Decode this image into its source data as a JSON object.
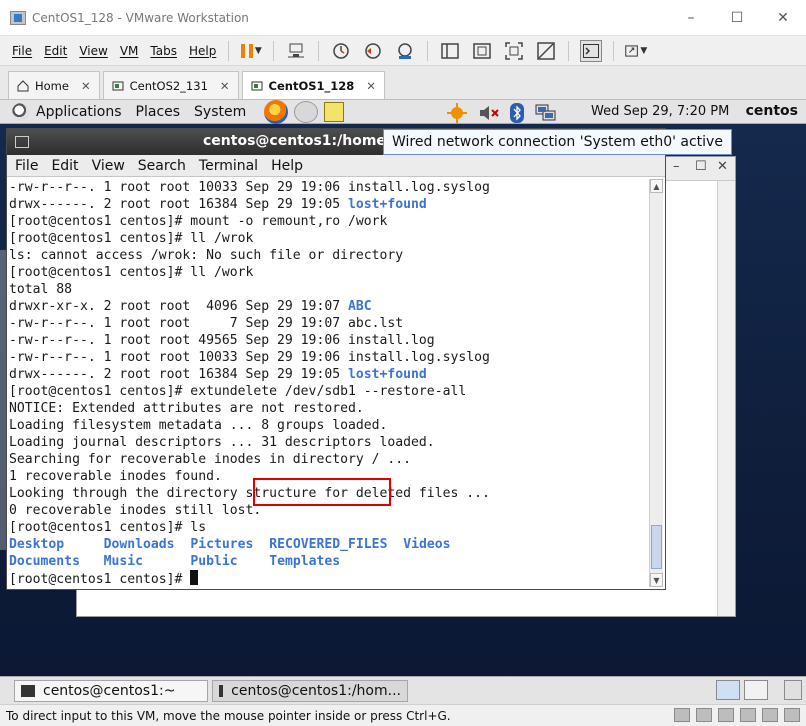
{
  "vmware": {
    "title": "CentOS1_128 - VMware Workstation",
    "window_controls": [
      "–",
      "☐",
      "✕"
    ],
    "menu": [
      "File",
      "Edit",
      "View",
      "VM",
      "Tabs",
      "Help"
    ],
    "tabs": [
      {
        "label": "Home",
        "close": "✕"
      },
      {
        "label": "CentOS2_131",
        "close": "✕"
      },
      {
        "label": "CentOS1_128",
        "close": "✕"
      }
    ],
    "status_text": "To direct input to this VM, move the mouse pointer inside or press Ctrl+G."
  },
  "gnome": {
    "top_menu": [
      "Applications",
      "Places",
      "System"
    ],
    "clock": "Wed Sep 29,  7:20 PM",
    "user": "centos",
    "tooltip": "Wired network connection 'System eth0' active",
    "taskbar": [
      {
        "label": "centos@centos1:~"
      },
      {
        "label": "centos@centos1:/hom..."
      }
    ]
  },
  "terminal": {
    "title": "centos@centos1:/home/c",
    "menu": [
      "File",
      "Edit",
      "View",
      "Search",
      "Terminal",
      "Help"
    ],
    "lines": [
      {
        "pre": "-rw-r--r--. 1 root root 10033 Sep 29 19:06 install.log.syslog"
      },
      {
        "pre": "drwx------. 2 root root 16384 Sep 29 19:05 ",
        "blue": "lost+found"
      },
      {
        "pre": "[root@centos1 centos]# mount -o remount,ro /work"
      },
      {
        "pre": "[root@centos1 centos]# ll /wrok"
      },
      {
        "pre": "ls: cannot access /wrok: No such file or directory"
      },
      {
        "pre": "[root@centos1 centos]# ll /work"
      },
      {
        "pre": "total 88"
      },
      {
        "pre": "drwxr-xr-x. 2 root root  4096 Sep 29 19:07 ",
        "blue": "ABC"
      },
      {
        "pre": "-rw-r--r--. 1 root root     7 Sep 29 19:07 abc.lst"
      },
      {
        "pre": "-rw-r--r--. 1 root root 49565 Sep 29 19:06 install.log"
      },
      {
        "pre": "-rw-r--r--. 1 root root 10033 Sep 29 19:06 install.log.syslog"
      },
      {
        "pre": "drwx------. 2 root root 16384 Sep 29 19:05 ",
        "blue": "lost+found"
      },
      {
        "pre": "[root@centos1 centos]# extundelete /dev/sdb1 --restore-all"
      },
      {
        "pre": "NOTICE: Extended attributes are not restored."
      },
      {
        "pre": "Loading filesystem metadata ... 8 groups loaded."
      },
      {
        "pre": "Loading journal descriptors ... 31 descriptors loaded."
      },
      {
        "pre": "Searching for recoverable inodes in directory / ..."
      },
      {
        "pre": "1 recoverable inodes found."
      },
      {
        "pre": "Looking through the directory structure for deleted files ..."
      },
      {
        "pre": "0 recoverable inodes still lost."
      },
      {
        "pre": "[root@centos1 centos]# ls"
      }
    ],
    "ls_row1": [
      "Desktop",
      "Downloads",
      "Pictures",
      "RECOVERED_FILES",
      "Videos"
    ],
    "ls_row2": [
      "Documents",
      "Music",
      "Public",
      "Templates"
    ],
    "prompt": "[root@centos1 centos]# "
  },
  "colors": {
    "dir_blue": "#3b74d4",
    "highlight_red": "#e00000",
    "pause_orange": "#f08000"
  },
  "icons": [
    "home-icon",
    "vm-tab-icon",
    "pause-icon",
    "send-ctrl-alt-del-icon",
    "snapshot-icon",
    "revert-snapshot-icon",
    "snapshot-manager-icon",
    "view-icon",
    "fullscreen-icon",
    "unity-icon",
    "console-icon",
    "stretch-icon",
    "firefox-icon",
    "mail-icon",
    "notes-icon",
    "update-icon",
    "volume-muted-icon",
    "bluetooth-icon",
    "network-icon",
    "terminal-icon"
  ]
}
